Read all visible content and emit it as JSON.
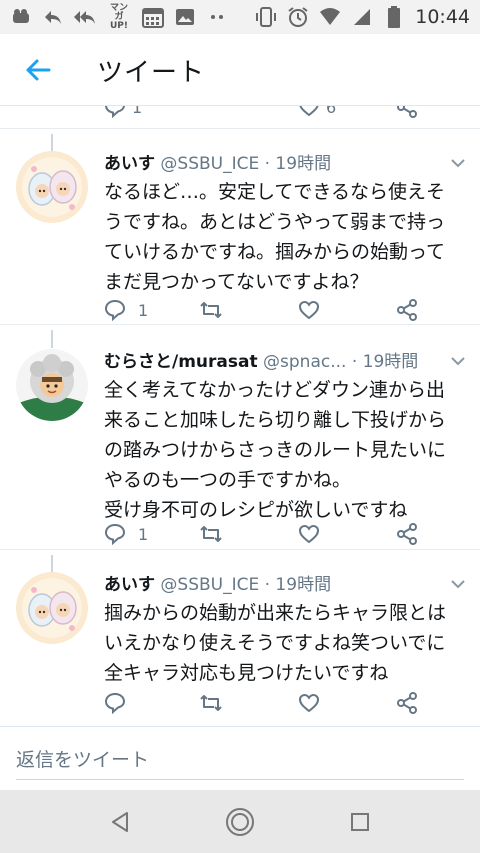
{
  "status_bar": {
    "time": "10:44",
    "left_icons": [
      "notification-icon",
      "reply-arrow-icon",
      "reply-all-icon",
      "manga-up-icon",
      "calendar-icon",
      "image-icon",
      "more-dots-icon"
    ],
    "manga_up_label": "マンガ UP!",
    "right_icons": [
      "vibrate-icon",
      "alarm-icon",
      "wifi-icon",
      "signal-icon",
      "battery-icon"
    ]
  },
  "app_bar": {
    "title": "ツイート",
    "back_icon": "arrow-left-icon"
  },
  "tweets": [
    {
      "name": "あいす",
      "handle": "@SSBU_ICE",
      "time": "· 19時間",
      "text_lines": [
        "なるほど…。安定してできるなら使えそ",
        "うですね。あとはどうやって弱まで持っ",
        "ていけるかですね。掴みからの始動って",
        "まだ見つかってないですよね？"
      ],
      "reply_count": "1",
      "avatar": "ice-climbers-avatar"
    },
    {
      "name": "むらさと/murasat",
      "handle": "@spnac...",
      "time": "· 19時間",
      "text_lines": [
        "全く考えてなかったけどダウン連から出",
        "来ること加味したら切り離し下投げから",
        "の踏みつけからさっきのルート見たいに",
        "やるのも一つの手ですかね。",
        "受け身不可のレシピが欲しいですね"
      ],
      "reply_count": "1",
      "avatar": "helmet-character-avatar"
    },
    {
      "name": "あいす",
      "handle": "@SSBU_ICE",
      "time": "· 19時間",
      "text_lines": [
        "掴みからの始動が出来たらキャラ限とは",
        "いえかなり使えそうですよね笑ついでに",
        "全キャラ対応も見つけたいですね"
      ],
      "reply_count": "",
      "avatar": "ice-climbers-avatar"
    }
  ],
  "partial_top": {
    "reply_count": "1",
    "like_count": "6"
  },
  "reply_box": {
    "placeholder": "返信をツイート"
  },
  "colors": {
    "accent": "#1da1f2",
    "text": "#14171a",
    "secondary": "#657786",
    "divider": "#e6ecf0",
    "nav_bar": "#e8e8e8"
  }
}
